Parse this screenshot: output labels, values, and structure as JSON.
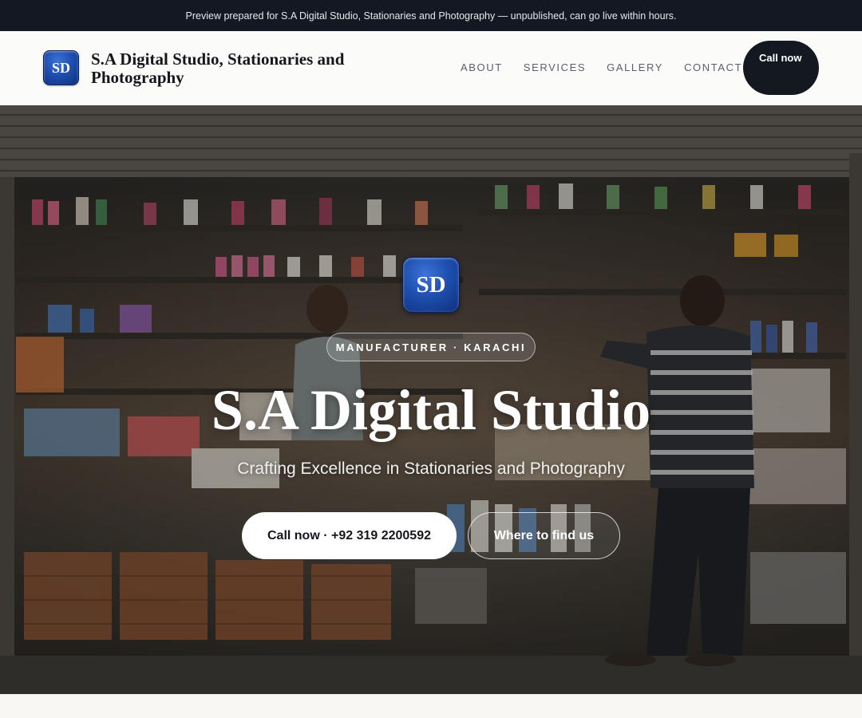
{
  "preview_banner": "Preview prepared for S.A Digital Studio, Stationaries and Photography — unpublished, can go live within hours.",
  "header": {
    "logo_text": "SD",
    "brand_name": "S.A Digital Studio, Stationaries and Photography",
    "nav": [
      "ABOUT",
      "SERVICES",
      "GALLERY",
      "CONTACT"
    ],
    "call_button": "Call now"
  },
  "hero": {
    "logo_text": "SD",
    "tag": "MANUFACTURER · KARACHI",
    "title": "S.A Digital Studio",
    "subtitle": "Crafting Excellence in Stationaries and Photography",
    "primary_cta": "Call now · +92 319 2200592",
    "secondary_cta": "Where to find us",
    "background_image": "shop-storefront-photo"
  },
  "colors": {
    "topbar_bg": "#131822",
    "header_bg": "#fbfbf9",
    "dark_button": "#141820",
    "logo_blue": "#1e4fb0",
    "page_bg": "#f8f7f3"
  }
}
